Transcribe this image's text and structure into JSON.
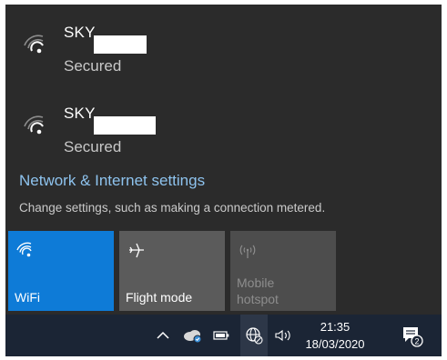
{
  "networks": [
    {
      "ssid": "SKY",
      "status": "Secured"
    },
    {
      "ssid": "SKY",
      "status": "Secured"
    }
  ],
  "settings": {
    "link": "Network & Internet settings",
    "description": "Change settings, such as making a connection metered."
  },
  "quick_actions": [
    {
      "label": "WiFi",
      "icon": "wifi-icon",
      "active": true
    },
    {
      "label": "Flight mode",
      "icon": "airplane-icon",
      "active": false
    },
    {
      "label": "Mobile hotspot",
      "icon": "mobile-hotspot-icon",
      "active": false,
      "disabled": true
    }
  ],
  "taskbar": {
    "time": "21:35",
    "date": "18/03/2020",
    "notification_count": "2"
  },
  "colors": {
    "flyout_bg": "#2b2b2b",
    "accent": "#0e7bd7",
    "link": "#8ec3ee",
    "taskbar_bg": "#1b2535"
  }
}
